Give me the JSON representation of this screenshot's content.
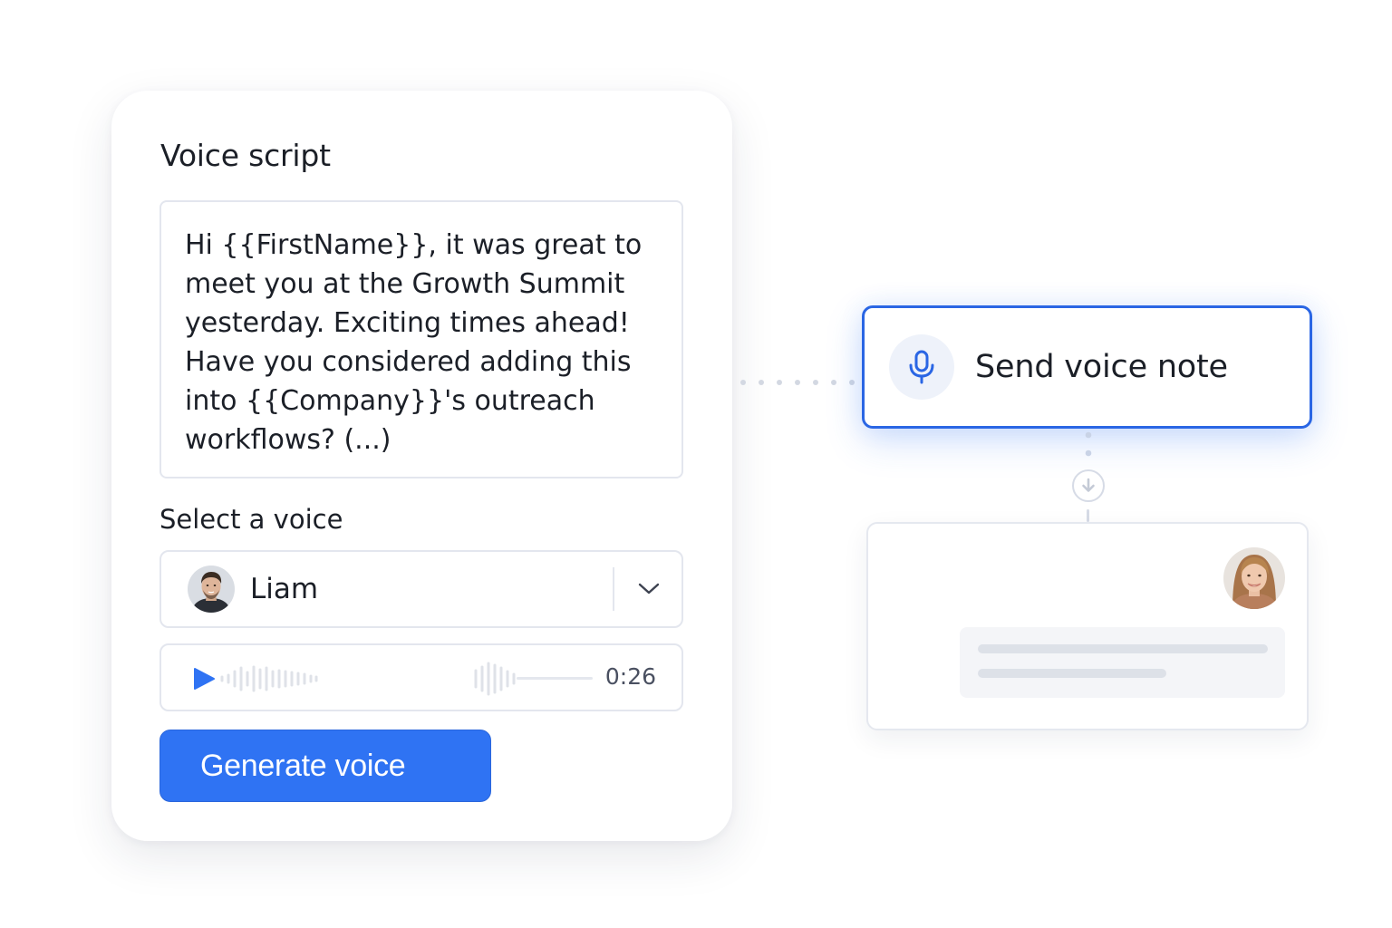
{
  "script_card": {
    "title": "Voice script",
    "script_text": "Hi {{FirstName}}, it was great to\nmeet you at the Growth Summit\nyesterday. Exciting times ahead!\nHave you considered adding this\ninto {{Company}}'s outreach\nworkflows? (...)",
    "voice_label": "Select a voice",
    "selected_voice": "Liam",
    "audio_duration": "0:26",
    "generate_button": "Generate voice"
  },
  "workflow": {
    "send_node_label": "Send voice note",
    "send_node_icon": "microphone-icon",
    "connector_icon": "arrow-down-icon"
  },
  "colors": {
    "accent": "#2f73f3",
    "node_border": "#2a66e4",
    "border": "#e3e6ee",
    "muted": "#dde1e8"
  }
}
